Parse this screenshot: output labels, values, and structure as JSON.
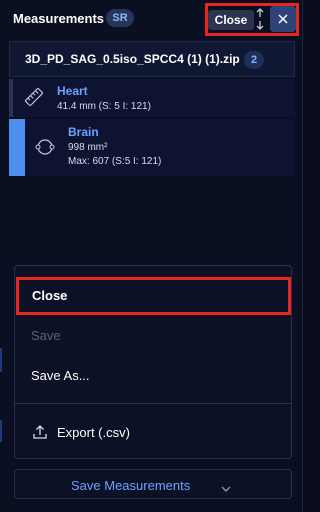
{
  "header": {
    "title": "Measurements",
    "badge": "SR",
    "close_label": "Close"
  },
  "study": {
    "name": "3D_PD_SAG_0.5iso_SPCC4 (1) (1).zip",
    "count": "2"
  },
  "measurements": [
    {
      "label": "Heart",
      "lines": [
        "41.4 mm (S: 5 I: 121)"
      ],
      "icon": "ruler-icon"
    },
    {
      "label": "Brain",
      "lines": [
        "998 mm²",
        "Max: 607 (S:5 I: 121)"
      ],
      "icon": "ellipse-roi-icon"
    }
  ],
  "menu": {
    "close": "Close",
    "save": "Save",
    "save_as": "Save As...",
    "export": "Export (.csv)"
  },
  "footer": {
    "save_measurements": "Save Measurements"
  },
  "colors": {
    "background": "#0b0f22",
    "accent": "#4f8ff0",
    "highlight": "#e8261f",
    "label_blue": "#6aa3ff"
  }
}
